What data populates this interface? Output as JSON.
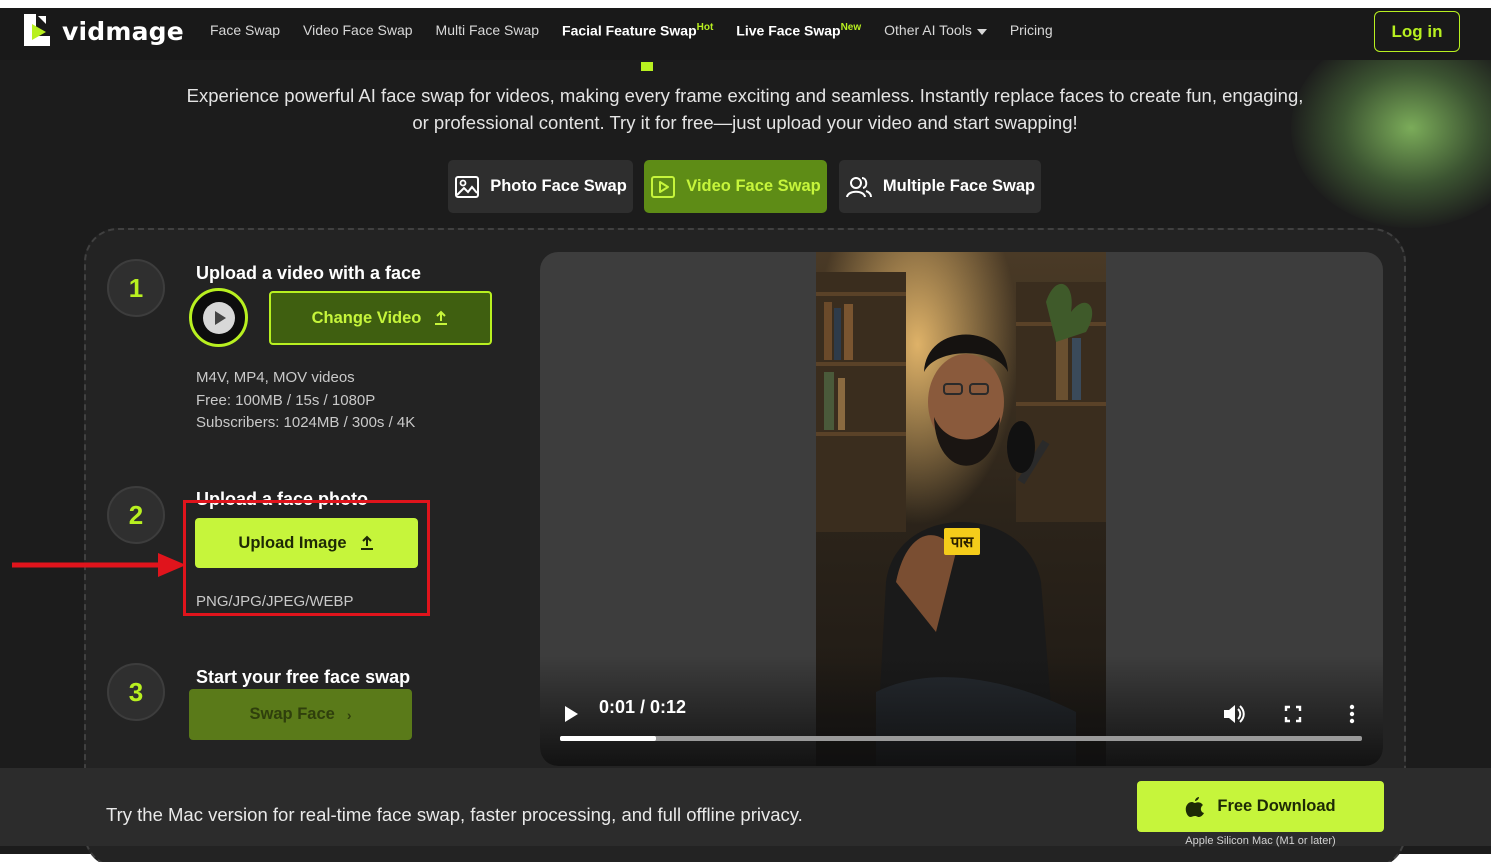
{
  "nav": {
    "brand": "vidmage",
    "links": [
      {
        "label": "Face Swap"
      },
      {
        "label": "Video Face Swap"
      },
      {
        "label": "Multi Face Swap"
      },
      {
        "label": "Facial Feature Swap",
        "badge": "Hot"
      },
      {
        "label": "Live Face Swap",
        "badge": "New"
      },
      {
        "label": "Other AI Tools"
      },
      {
        "label": "Pricing"
      }
    ],
    "login_label": "Log in"
  },
  "intro": {
    "line1": "Experience powerful AI face swap for videos, making every frame exciting and seamless. Instantly replace faces to create fun, engaging,",
    "line2": "or professional content. Try it for free—just upload your video and start swapping!"
  },
  "modes": [
    {
      "label": "Photo Face Swap",
      "icon": "image-icon",
      "active": false
    },
    {
      "label": "Video Face Swap",
      "icon": "video-icon",
      "active": true
    },
    {
      "label": "Multiple Face Swap",
      "icon": "users-icon",
      "active": false
    }
  ],
  "steps": {
    "step1": {
      "number": "1",
      "title": "Upload a video with a face",
      "button": "Change Video",
      "formats": "M4V, MP4, MOV videos",
      "free_limit": "Free: 100MB / 15s / 1080P",
      "sub_limit": "Subscribers: 1024MB / 300s / 4K"
    },
    "step2": {
      "number": "2",
      "title": "Upload a face photo",
      "button": "Upload Image",
      "formats": "PNG/JPG/JPEG/WEBP"
    },
    "step3": {
      "number": "3",
      "title": "Start your free face swap",
      "button": "Swap Face"
    }
  },
  "player": {
    "time": "0:01 / 0:12",
    "progress": 0.12,
    "subtitle": "पास"
  },
  "bottom": {
    "text": "Try the Mac version for real-time face swap, faster processing, and full offline privacy.",
    "download_label": "Free Download",
    "download_note": "Apple Silicon Mac (M1 or later)"
  },
  "colors": {
    "accent": "#c6f53b",
    "background": "#1c1c1c",
    "highlight": "#e0141c"
  }
}
